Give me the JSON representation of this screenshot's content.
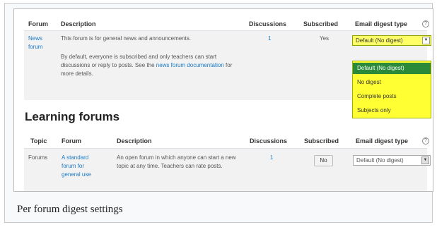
{
  "forum_table": {
    "headers": {
      "forum": "Forum",
      "description": "Description",
      "discussions": "Discussions",
      "subscribed": "Subscribed",
      "digest": "Email digest type"
    },
    "row": {
      "forum_name": "News forum",
      "desc_line1": "This forum is for general news and announcements.",
      "desc_para2_prefix": "By default, everyone is subscribed and only teachers can start discussions or reply to posts. See the",
      "desc_link": "news forum documentation",
      "desc_suffix": "for more details.",
      "discussions": "1",
      "subscribed": "Yes",
      "digest_selected": "Default (No digest)"
    },
    "dropdown_options": [
      "Default (No digest)",
      "No digest",
      "Complete posts",
      "Subjects only"
    ]
  },
  "learning": {
    "title": "Learning forums",
    "headers": {
      "topic": "Topic",
      "forum": "Forum",
      "description": "Description",
      "discussions": "Discussions",
      "subscribed": "Subscribed",
      "digest": "Email digest type"
    },
    "row": {
      "topic": "Forums",
      "forum_name": "A standard forum for general use",
      "description": "An open forum in which anyone can start a new topic at any time. Teachers can rate posts.",
      "discussions": "1",
      "subscribe_button": "No",
      "digest_selected": "Default (No digest)"
    }
  },
  "icons": {
    "help": "help-icon",
    "dropdown": "chevron-down-icon"
  },
  "colors": {
    "highlight": "#ffff33",
    "selected_option": "#2a8a39",
    "link": "#1a79c5"
  },
  "caption": "Per forum digest settings"
}
